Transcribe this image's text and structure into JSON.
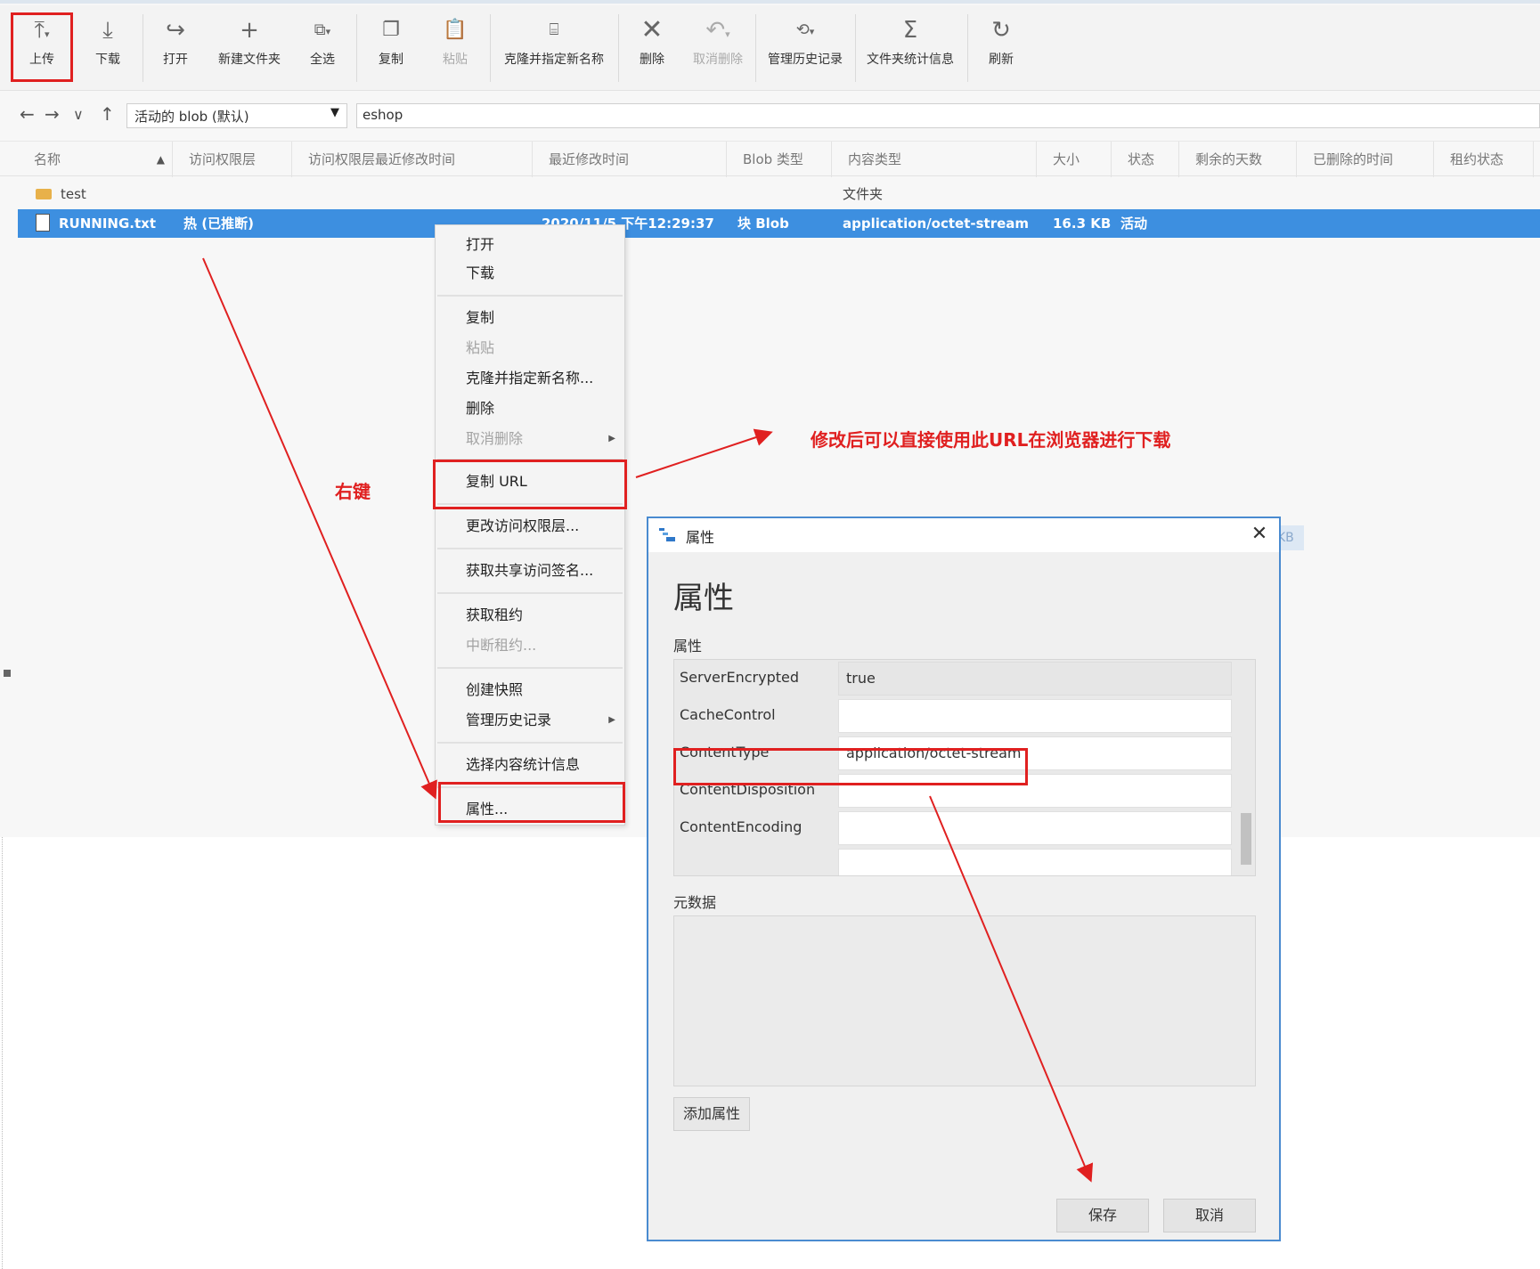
{
  "toolbar": {
    "upload": "上传",
    "download": "下载",
    "open": "打开",
    "new_folder": "新建文件夹",
    "select_all": "全选",
    "copy": "复制",
    "paste": "粘贴",
    "clone_rename": "克隆并指定新名称",
    "delete": "删除",
    "undelete": "取消删除",
    "manage_history": "管理历史记录",
    "folder_stats": "文件夹统计信息",
    "refresh": "刷新"
  },
  "address": {
    "blob_select": "活动的 blob (默认)",
    "path": "eshop"
  },
  "columns": [
    "名称",
    "访问权限层",
    "访问权限层最近修改时间",
    "最近修改时间",
    "Blob 类型",
    "内容类型",
    "大小",
    "状态",
    "剩余的天数",
    "已删除的时间",
    "租约状态"
  ],
  "rows": [
    {
      "name": "test",
      "tier": "",
      "modified": "",
      "blob_type": "",
      "content_type": "文件夹",
      "size": "",
      "status": ""
    },
    {
      "name": "RUNNING.txt",
      "tier": "热 (已推断)",
      "modified": "2020/11/5 下午12:29:37",
      "blob_type": "块 Blob",
      "content_type": "application/octet-stream",
      "size": "16.3 KB",
      "status": "活动"
    }
  ],
  "context_menu": {
    "open": "打开",
    "download": "下载",
    "copy": "复制",
    "paste": "粘贴",
    "clone": "克隆并指定新名称...",
    "delete": "删除",
    "undelete": "取消删除",
    "copy_url": "复制 URL",
    "change_tier": "更改访问权限层...",
    "get_sas": "获取共享访问签名...",
    "acquire_lease": "获取租约",
    "break_lease": "中断租约...",
    "create_snapshot": "创建快照",
    "manage_history": "管理历史记录",
    "content_stats": "选择内容统计信息",
    "properties": "属性..."
  },
  "annotations": {
    "right_click": "右键",
    "url_note": "修改后可以直接使用此URL在浏览器进行下载"
  },
  "dialog": {
    "title": "属性",
    "heading": "属性",
    "props_label": "属性",
    "properties": [
      {
        "name": "ServerEncrypted",
        "value": "true"
      },
      {
        "name": "CacheControl",
        "value": ""
      },
      {
        "name": "ContentType",
        "value": "application/octet-stream"
      },
      {
        "name": "ContentDisposition",
        "value": ""
      },
      {
        "name": "ContentEncoding",
        "value": ""
      }
    ],
    "metadata_label": "元数据",
    "add_property": "添加属性",
    "save": "保存",
    "cancel": "取消",
    "close_glyph": "✕"
  },
  "background_fragment": "KB",
  "colors": {
    "selection": "#3d8fe0",
    "highlight_red": "#e02020",
    "dialog_border": "#4a8bd0"
  },
  "icons": {
    "upload": "upload-icon",
    "download": "download-icon",
    "open": "open-arrow-icon",
    "new_folder": "plus-icon",
    "select_all": "select-all-icon",
    "copy": "copy-icon",
    "paste": "paste-icon",
    "clone": "clone-icon",
    "delete": "x-icon",
    "undelete": "undo-icon",
    "history": "history-icon",
    "stats": "sigma-icon",
    "refresh": "refresh-icon"
  }
}
